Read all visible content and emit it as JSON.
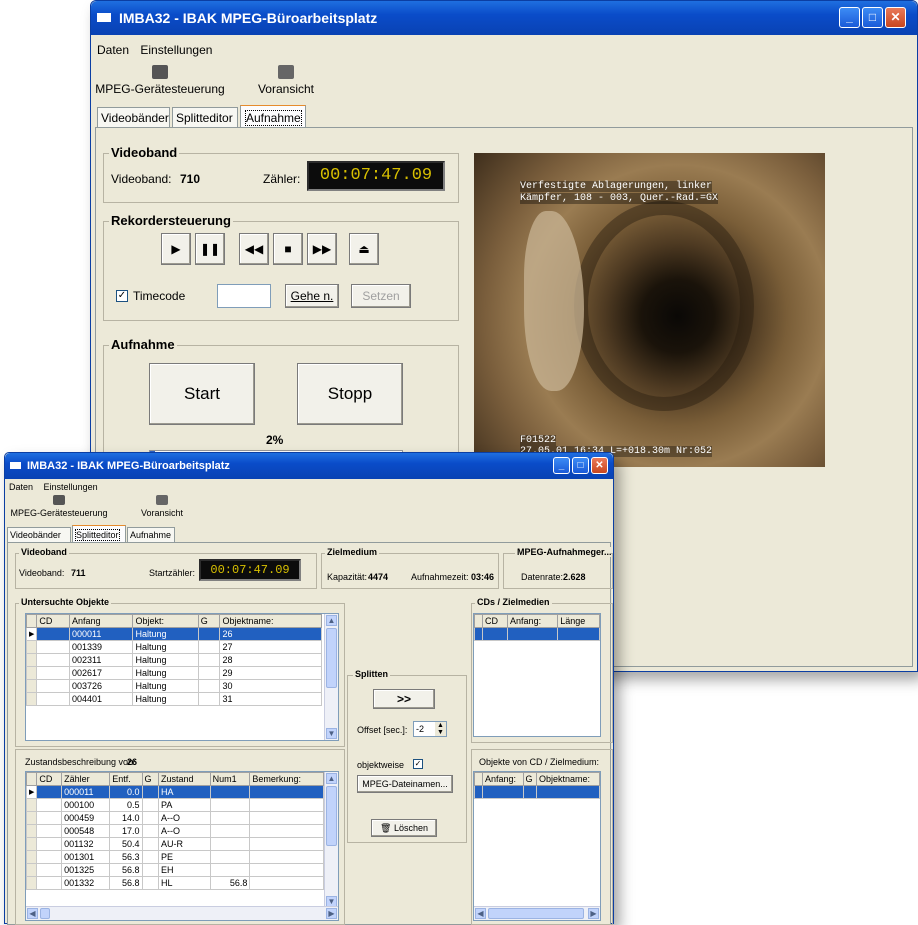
{
  "back_window": {
    "title": "IMBA32  -  IBAK MPEG-Büroarbeitsplatz",
    "menu": [
      "Daten",
      "Einstellungen"
    ],
    "toolbar": [
      {
        "label": "MPEG-Gerätesteuerung",
        "icon": "device-control-icon"
      },
      {
        "label": "Voransicht",
        "icon": "preview-icon"
      }
    ],
    "tabs": [
      "Videobänder",
      "Splitteditor",
      "Aufnahme"
    ],
    "active_tab": "Aufnahme",
    "videoband": {
      "group_title": "Videoband",
      "label": "Videoband:",
      "value": "710",
      "counter_label": "Zähler:",
      "counter": "00:07:47.09"
    },
    "recorder": {
      "group_title": "Rekordersteuerung",
      "buttons": [
        "play",
        "pause",
        "rewind",
        "stop",
        "fast-forward",
        "eject"
      ],
      "timecode_label": "Timecode",
      "timecode_checked": true,
      "timecode_value": "",
      "goto_label": "Gehe n.",
      "set_label": "Setzen"
    },
    "recording": {
      "group_title": "Aufnahme",
      "start_label": "Start",
      "stop_label": "Stopp",
      "progress_text": "2%",
      "progress_fraction": 0.02
    },
    "video_overlay": {
      "line1": "Verfestigte Ablagerungen, linker",
      "line2": "Kämpfer, 108 - 003, Quer.-Rad.=GX",
      "line3": "F01522",
      "line4": "27.05.01 16:34 L=+018.30m Nr:052"
    }
  },
  "front_window": {
    "title": "IMBA32  -  IBAK MPEG-Büroarbeitsplatz",
    "menu": [
      "Daten",
      "Einstellungen"
    ],
    "toolbar": [
      {
        "label": "MPEG-Gerätesteuerung",
        "icon": "device-control-icon"
      },
      {
        "label": "Voransicht",
        "icon": "preview-icon"
      }
    ],
    "tabs": [
      "Videobänder",
      "Splitteditor",
      "Aufnahme"
    ],
    "active_tab": "Splitteditor",
    "videoband": {
      "group_title": "Videoband",
      "label": "Videoband:",
      "value": "711",
      "start_counter_label": "Startzähler:",
      "start_counter": "00:07:47.09"
    },
    "zielmedium": {
      "group_title": "Zielmedium",
      "capacity_label": "Kapazität:",
      "capacity": "4474",
      "time_label": "Aufnahmezeit:",
      "time": "03:46"
    },
    "mpeg_rec": {
      "group_title": "MPEG-Aufnahmeger...",
      "rate_label": "Datenrate:",
      "rate": "2.628"
    },
    "objects": {
      "group_title": "Untersuchte Objekte",
      "columns": [
        "CD",
        "Anfang",
        "Objekt:",
        "G",
        "Objektname:"
      ],
      "rows": [
        [
          "",
          "000011",
          "Haltung",
          "",
          "26"
        ],
        [
          "",
          "001339",
          "Haltung",
          "",
          "27"
        ],
        [
          "",
          "002311",
          "Haltung",
          "",
          "28"
        ],
        [
          "",
          "002617",
          "Haltung",
          "",
          "29"
        ],
        [
          "",
          "003726",
          "Haltung",
          "",
          "30"
        ],
        [
          "",
          "004401",
          "Haltung",
          "",
          "31"
        ]
      ],
      "selected_row": 0
    },
    "condition": {
      "label": "Zustandsbeschreibung von:",
      "value": "26",
      "columns": [
        "CD",
        "Zähler",
        "Entf.",
        "G",
        "Zustand",
        "Num1",
        "Bemerkung:"
      ],
      "rows": [
        [
          "",
          "000011",
          "0.0",
          "",
          "HA",
          "",
          ""
        ],
        [
          "",
          "000100",
          "0.5",
          "",
          "PA",
          "",
          ""
        ],
        [
          "",
          "000459",
          "14.0",
          "",
          "A--O",
          "",
          ""
        ],
        [
          "",
          "000548",
          "17.0",
          "",
          "A--O",
          "",
          ""
        ],
        [
          "",
          "001132",
          "50.4",
          "",
          "AU-R",
          "",
          ""
        ],
        [
          "",
          "001301",
          "56.3",
          "",
          "PE",
          "",
          ""
        ],
        [
          "",
          "001325",
          "56.8",
          "",
          "EH",
          "",
          ""
        ],
        [
          "",
          "001332",
          "56.8",
          "",
          "HL",
          "56.8",
          ""
        ]
      ],
      "selected_row": 0
    },
    "split": {
      "group_title": "Splitten",
      "go_label": ">>",
      "offset_label": "Offset [sec.]:",
      "offset_value": "-2",
      "objectwise_label": "objektweise",
      "objectwise_checked": true,
      "mpeg_names_label": "MPEG-Dateinamen...",
      "delete_label": "Löschen"
    },
    "cds": {
      "group_title": "CDs / Zielmedien",
      "columns": [
        "CD",
        "Anfang:",
        "Länge"
      ]
    },
    "cd_objects": {
      "label": "Objekte von CD / Zielmedium:",
      "columns": [
        "Anfang:",
        "G",
        "Objektname:"
      ]
    }
  }
}
